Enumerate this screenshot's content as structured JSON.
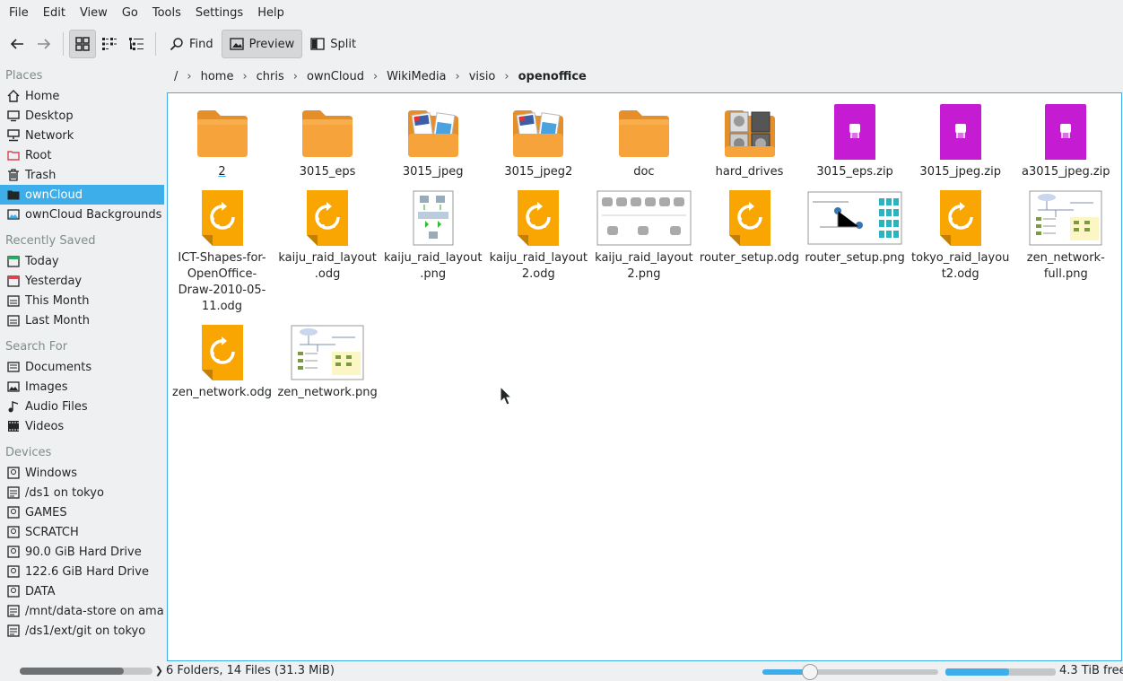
{
  "menu": [
    "File",
    "Edit",
    "View",
    "Go",
    "Tools",
    "Settings",
    "Help"
  ],
  "toolbar": {
    "find": "Find",
    "preview": "Preview",
    "split": "Split"
  },
  "places": {
    "title": "Places",
    "items": [
      "Home",
      "Desktop",
      "Network",
      "Root",
      "Trash",
      "ownCloud",
      "ownCloud Backgrounds"
    ]
  },
  "recent": {
    "title": "Recently Saved",
    "items": [
      "Today",
      "Yesterday",
      "This Month",
      "Last Month"
    ]
  },
  "search": {
    "title": "Search For",
    "items": [
      "Documents",
      "Images",
      "Audio Files",
      "Videos"
    ]
  },
  "devices": {
    "title": "Devices",
    "items": [
      "Windows",
      "/ds1 on tokyo",
      "GAMES",
      "SCRATCH",
      "90.0 GiB Hard Drive",
      "122.6 GiB Hard Drive",
      "DATA",
      "/mnt/data-store on amate",
      "/ds1/ext/git on tokyo"
    ]
  },
  "breadcrumb": [
    "/",
    "home",
    "chris",
    "ownCloud",
    "WikiMedia",
    "visio",
    "openoffice"
  ],
  "files": [
    {
      "name": "2",
      "type": "folder"
    },
    {
      "name": "3015_eps",
      "type": "folder"
    },
    {
      "name": "3015_jpeg",
      "type": "folder-images"
    },
    {
      "name": "3015_jpeg2",
      "type": "folder-images"
    },
    {
      "name": "doc",
      "type": "folder"
    },
    {
      "name": "hard_drives",
      "type": "folder-drives"
    },
    {
      "name": "3015_eps.zip",
      "type": "zip"
    },
    {
      "name": "3015_jpeg.zip",
      "type": "zip"
    },
    {
      "name": "a3015_jpeg.zip",
      "type": "zip"
    },
    {
      "name": "ICT-Shapes-for-OpenOffice-Draw-2010-05-11.odg",
      "type": "odg"
    },
    {
      "name": "kaiju_raid_layout.odg",
      "type": "odg"
    },
    {
      "name": "kaiju_raid_layout.png",
      "type": "png-raid"
    },
    {
      "name": "kaiju_raid_layout2.odg",
      "type": "odg"
    },
    {
      "name": "kaiju_raid_layout2.png",
      "type": "png-raid2"
    },
    {
      "name": "router_setup.odg",
      "type": "odg"
    },
    {
      "name": "router_setup.png",
      "type": "png-router"
    },
    {
      "name": "tokyo_raid_layout2.odg",
      "type": "odg"
    },
    {
      "name": "zen_network-full.png",
      "type": "png-zen"
    },
    {
      "name": "zen_network.odg",
      "type": "odg"
    },
    {
      "name": "zen_network.png",
      "type": "png-zen"
    }
  ],
  "status": {
    "summary": "6 Folders, 14 Files (31.3 MiB)",
    "free": "4.3 TiB free",
    "zoom": 0.27,
    "used_fraction": 0.58
  },
  "colors": {
    "accent": "#3daee9",
    "folder": "#f6a33c",
    "zip": "#c41bd3",
    "odg": "#f9a602"
  }
}
